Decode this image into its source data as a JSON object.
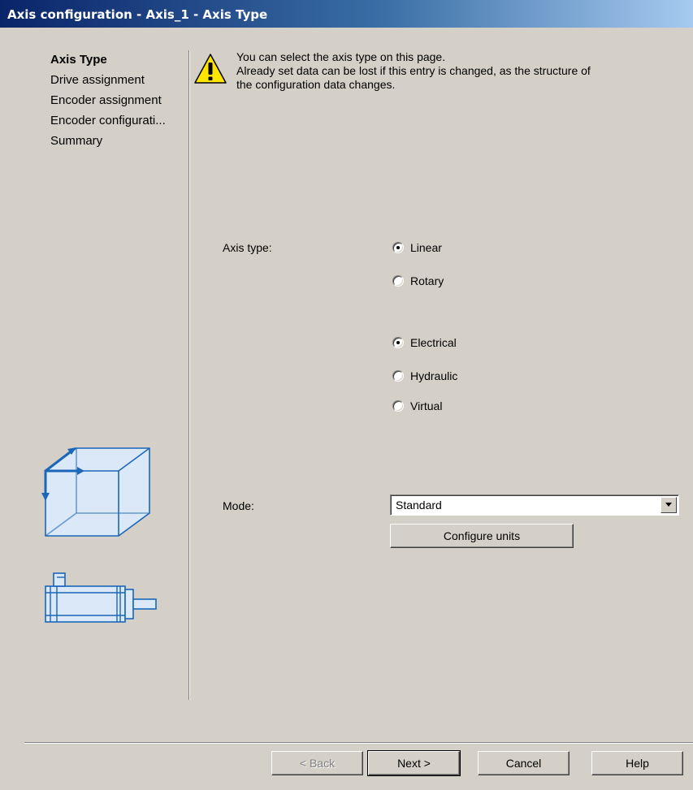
{
  "window": {
    "title": "Axis configuration - Axis_1 - Axis Type"
  },
  "nav": {
    "items": [
      {
        "label": "Axis Type",
        "active": true
      },
      {
        "label": "Drive assignment",
        "active": false
      },
      {
        "label": "Encoder assignment",
        "active": false
      },
      {
        "label": "Encoder configurati...",
        "active": false
      },
      {
        "label": "Summary",
        "active": false
      }
    ]
  },
  "info": {
    "line1": "You can select the axis type on this page.",
    "line2": "Already set data can be lost if this entry is changed, as the structure of",
    "line3": "the configuration data changes."
  },
  "form": {
    "axis_type_label": "Axis type:",
    "axis_type_options": [
      {
        "label": "Linear",
        "checked": true
      },
      {
        "label": "Rotary",
        "checked": false
      }
    ],
    "drive_type_options": [
      {
        "label": "Electrical",
        "checked": true
      },
      {
        "label": "Hydraulic",
        "checked": false
      },
      {
        "label": "Virtual",
        "checked": false
      }
    ],
    "mode_label": "Mode:",
    "mode_value": "Standard",
    "configure_units_label": "Configure units"
  },
  "footer": {
    "back_label": "< Back",
    "next_label": "Next >",
    "cancel_label": "Cancel",
    "help_label": "Help"
  },
  "icons": {
    "warning": "warning-icon",
    "axis_cube": "axis-cube-icon",
    "motor": "motor-icon",
    "dropdown": "chevron-down-icon"
  },
  "colors": {
    "title_bar_start": "#0a246a",
    "title_bar_end": "#a6caf0",
    "dialog_bg": "#d4d0c8",
    "illustration_blue": "#1b66b8"
  }
}
